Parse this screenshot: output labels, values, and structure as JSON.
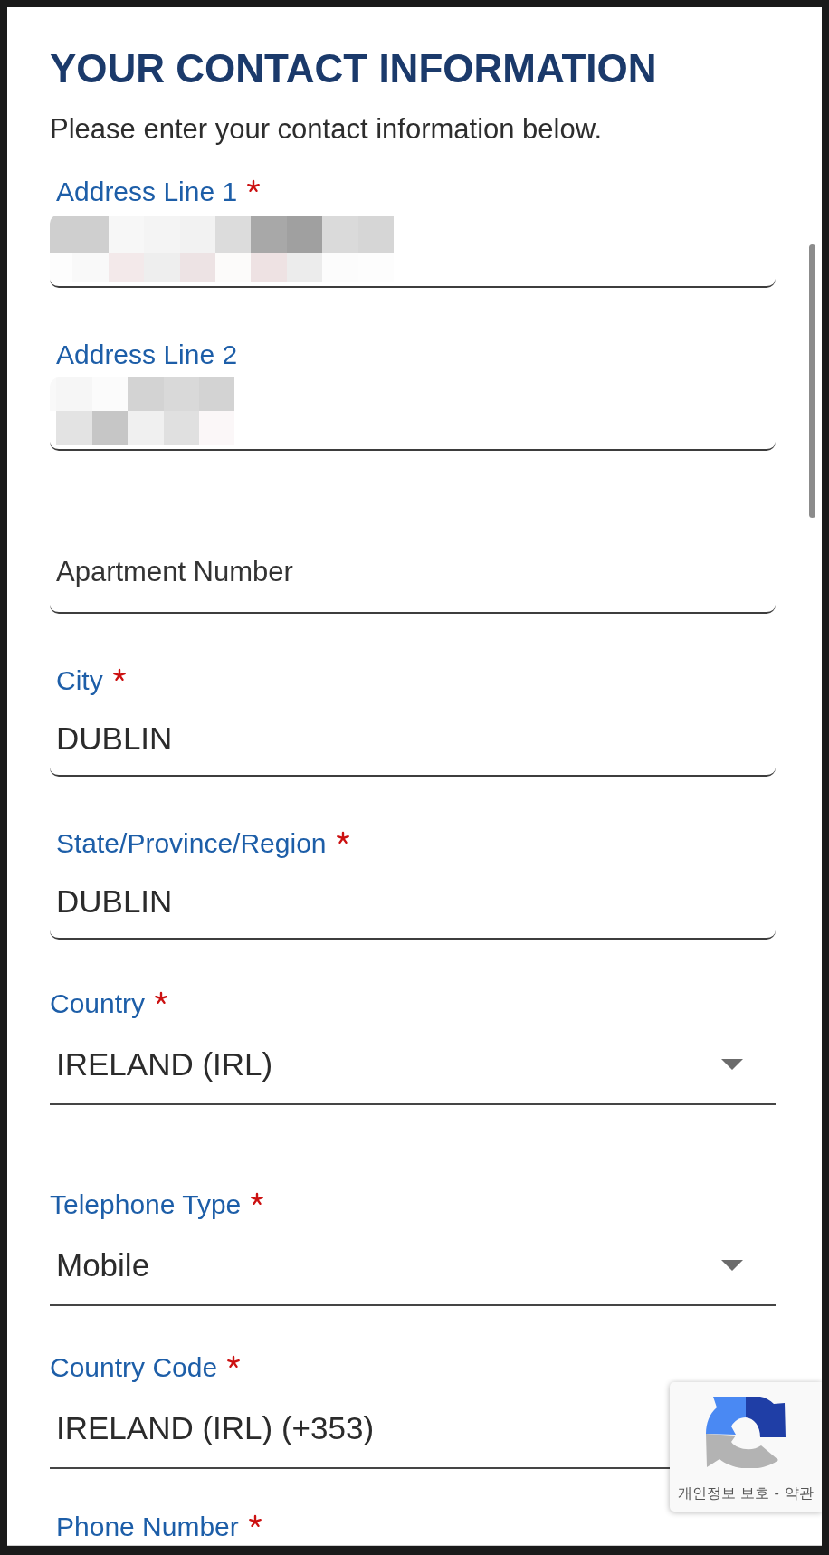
{
  "heading": {
    "title": "YOUR CONTACT INFORMATION",
    "subtitle": "Please enter your contact information below."
  },
  "fields": [
    {
      "kind": "text",
      "label": "Address Line 1",
      "required": true,
      "redacted": true
    },
    {
      "kind": "text",
      "label": "Address Line 2",
      "required": false,
      "redacted": true
    },
    {
      "kind": "text",
      "placeholder": "Apartment Number"
    },
    {
      "kind": "text",
      "label": "City",
      "required": true,
      "value": "DUBLIN"
    },
    {
      "kind": "text",
      "label": "State/Province/Region",
      "required": true,
      "value": "DUBLIN"
    },
    {
      "kind": "select",
      "label": "Country",
      "required": true,
      "value": "IRELAND (IRL)"
    },
    {
      "kind": "select",
      "label": "Telephone Type",
      "required": true,
      "value": "Mobile"
    },
    {
      "kind": "underline",
      "label": "Country Code",
      "required": true,
      "value": "IRELAND (IRL) (+353)"
    },
    {
      "kind": "label",
      "label": "Phone Number",
      "required": true
    }
  ],
  "captcha_badge": {
    "privacy_link": "개인정보 보호",
    "separator": "-",
    "terms_link": "약관"
  }
}
